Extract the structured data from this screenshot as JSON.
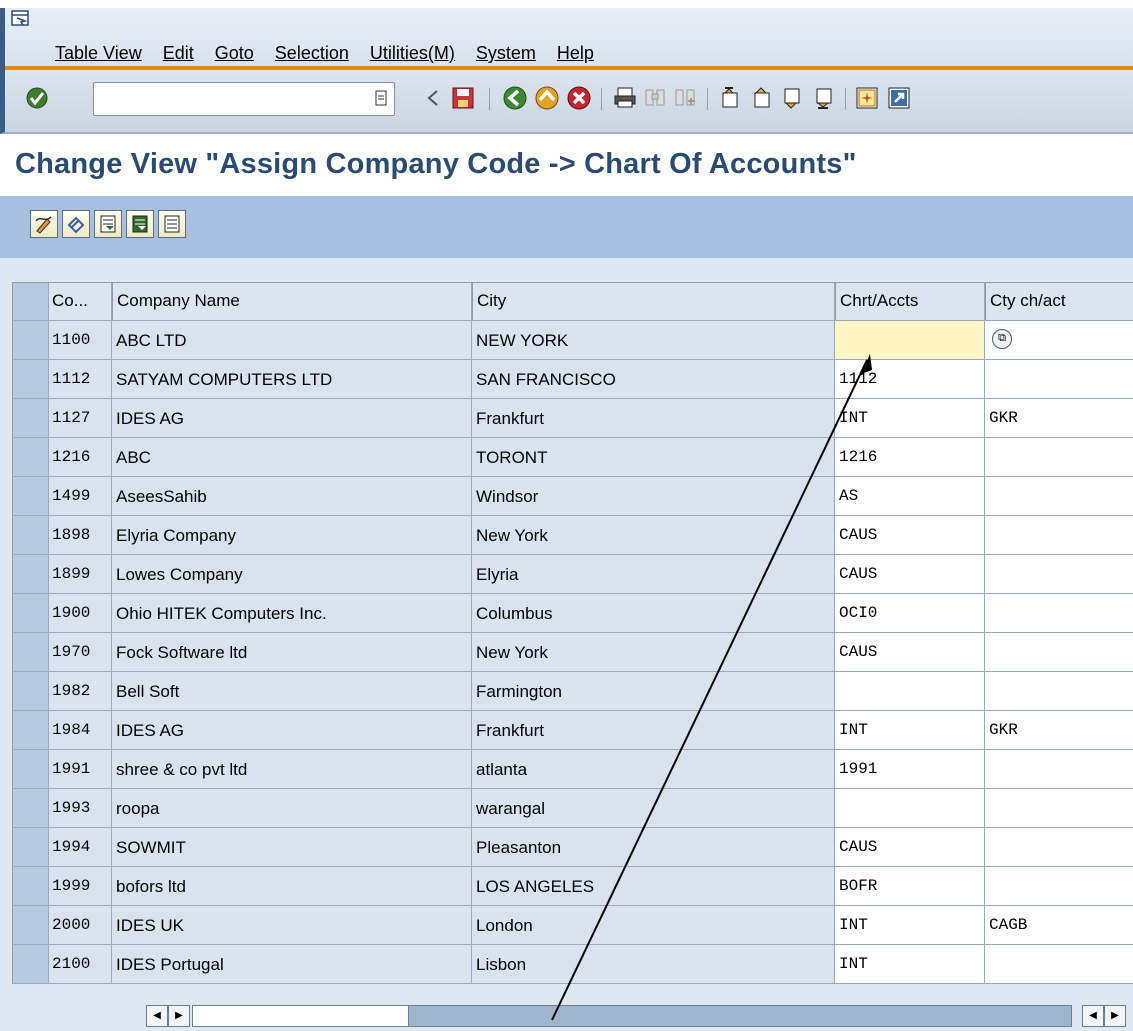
{
  "menu": {
    "items": [
      "Table View",
      "Edit",
      "Goto",
      "Selection",
      "Utilities(M)",
      "System",
      "Help"
    ]
  },
  "toolbar": {
    "command_field_value": "",
    "icons": [
      "enter-icon",
      "command-field",
      "back-nav-icon",
      "save-icon",
      "back-icon",
      "exit-icon",
      "cancel-icon",
      "print-icon",
      "find-icon",
      "find-next-icon",
      "first-page-icon",
      "previous-page-icon",
      "next-page-icon",
      "last-page-icon",
      "create-session-icon",
      "create-shortcut-icon"
    ]
  },
  "page": {
    "title": "Change View \"Assign Company Code -> Chart Of Accounts\""
  },
  "app_toolbar": {
    "icons": [
      "display-change-icon",
      "undo-changes-icon",
      "select-all-icon",
      "deselect-all-icon",
      "select-block-icon"
    ]
  },
  "table": {
    "headers": {
      "code": "Co...",
      "name": "Company Name",
      "city": "City",
      "chart": "Chrt/Accts",
      "country_chart": "Cty ch/act"
    },
    "rows": [
      {
        "code": "1100",
        "name": "ABC LTD",
        "city": "NEW YORK",
        "chart": "",
        "country_chart": ""
      },
      {
        "code": "1112",
        "name": "SATYAM COMPUTERS LTD",
        "city": "SAN FRANCISCO",
        "chart": "1112",
        "country_chart": ""
      },
      {
        "code": "1127",
        "name": "IDES AG",
        "city": "Frankfurt",
        "chart": "INT",
        "country_chart": "GKR"
      },
      {
        "code": "1216",
        "name": "ABC",
        "city": "TORONT",
        "chart": "1216",
        "country_chart": ""
      },
      {
        "code": "1499",
        "name": "AseesSahib",
        "city": "Windsor",
        "chart": "AS",
        "country_chart": ""
      },
      {
        "code": "1898",
        "name": "Elyria Company",
        "city": "New York",
        "chart": "CAUS",
        "country_chart": ""
      },
      {
        "code": "1899",
        "name": "Lowes Company",
        "city": "Elyria",
        "chart": "CAUS",
        "country_chart": ""
      },
      {
        "code": "1900",
        "name": "Ohio HITEK Computers Inc.",
        "city": "Columbus",
        "chart": "OCI0",
        "country_chart": ""
      },
      {
        "code": "1970",
        "name": "Fock Software ltd",
        "city": "New York",
        "chart": "CAUS",
        "country_chart": ""
      },
      {
        "code": "1982",
        "name": "Bell Soft",
        "city": "Farmington",
        "chart": "",
        "country_chart": ""
      },
      {
        "code": "1984",
        "name": "IDES AG",
        "city": "Frankfurt",
        "chart": "INT",
        "country_chart": "GKR"
      },
      {
        "code": "1991",
        "name": "shree & co pvt ltd",
        "city": "atlanta",
        "chart": "1991",
        "country_chart": ""
      },
      {
        "code": "1993",
        "name": "roopa",
        "city": "warangal",
        "chart": "",
        "country_chart": ""
      },
      {
        "code": "1994",
        "name": "SOWMIT",
        "city": "Pleasanton",
        "chart": "CAUS",
        "country_chart": ""
      },
      {
        "code": "1999",
        "name": "bofors ltd",
        "city": "LOS ANGELES",
        "chart": "BOFR",
        "country_chart": ""
      },
      {
        "code": "2000",
        "name": "IDES UK",
        "city": "London",
        "chart": "INT",
        "country_chart": "CAGB"
      },
      {
        "code": "2100",
        "name": "IDES Portugal",
        "city": "Lisbon",
        "chart": "INT",
        "country_chart": ""
      }
    ],
    "focused_row": 0
  },
  "colors": {
    "title": "#2a4c72",
    "menu_accent": "#e28a12",
    "app_toolbar": "#a6c0de",
    "focused_cell": "#fff4c2"
  }
}
